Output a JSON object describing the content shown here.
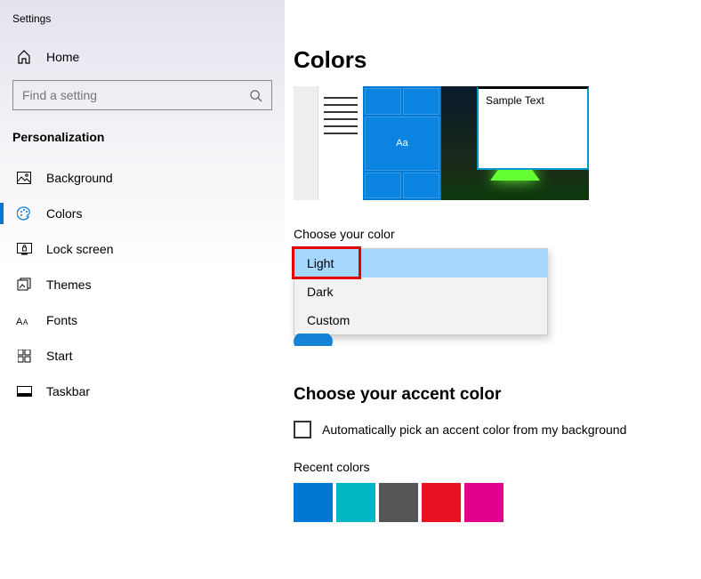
{
  "app_title": "Settings",
  "home_label": "Home",
  "search_placeholder": "Find a setting",
  "section_title": "Personalization",
  "nav": [
    {
      "label": "Background"
    },
    {
      "label": "Colors",
      "selected": true
    },
    {
      "label": "Lock screen"
    },
    {
      "label": "Themes"
    },
    {
      "label": "Fonts"
    },
    {
      "label": "Start"
    },
    {
      "label": "Taskbar"
    }
  ],
  "page_title": "Colors",
  "preview": {
    "sample_text": "Sample Text",
    "tile_label": "Aa"
  },
  "choose_color_label": "Choose your color",
  "color_options": [
    {
      "label": "Light",
      "selected": true,
      "highlighted": true
    },
    {
      "label": "Dark"
    },
    {
      "label": "Custom"
    }
  ],
  "accent_heading": "Choose your accent color",
  "auto_pick_label": "Automatically pick an accent color from my background",
  "recent_colors_label": "Recent colors",
  "recent_colors": [
    "#0078d4",
    "#00b7c3",
    "#555555",
    "#e81123",
    "#e3008c"
  ]
}
